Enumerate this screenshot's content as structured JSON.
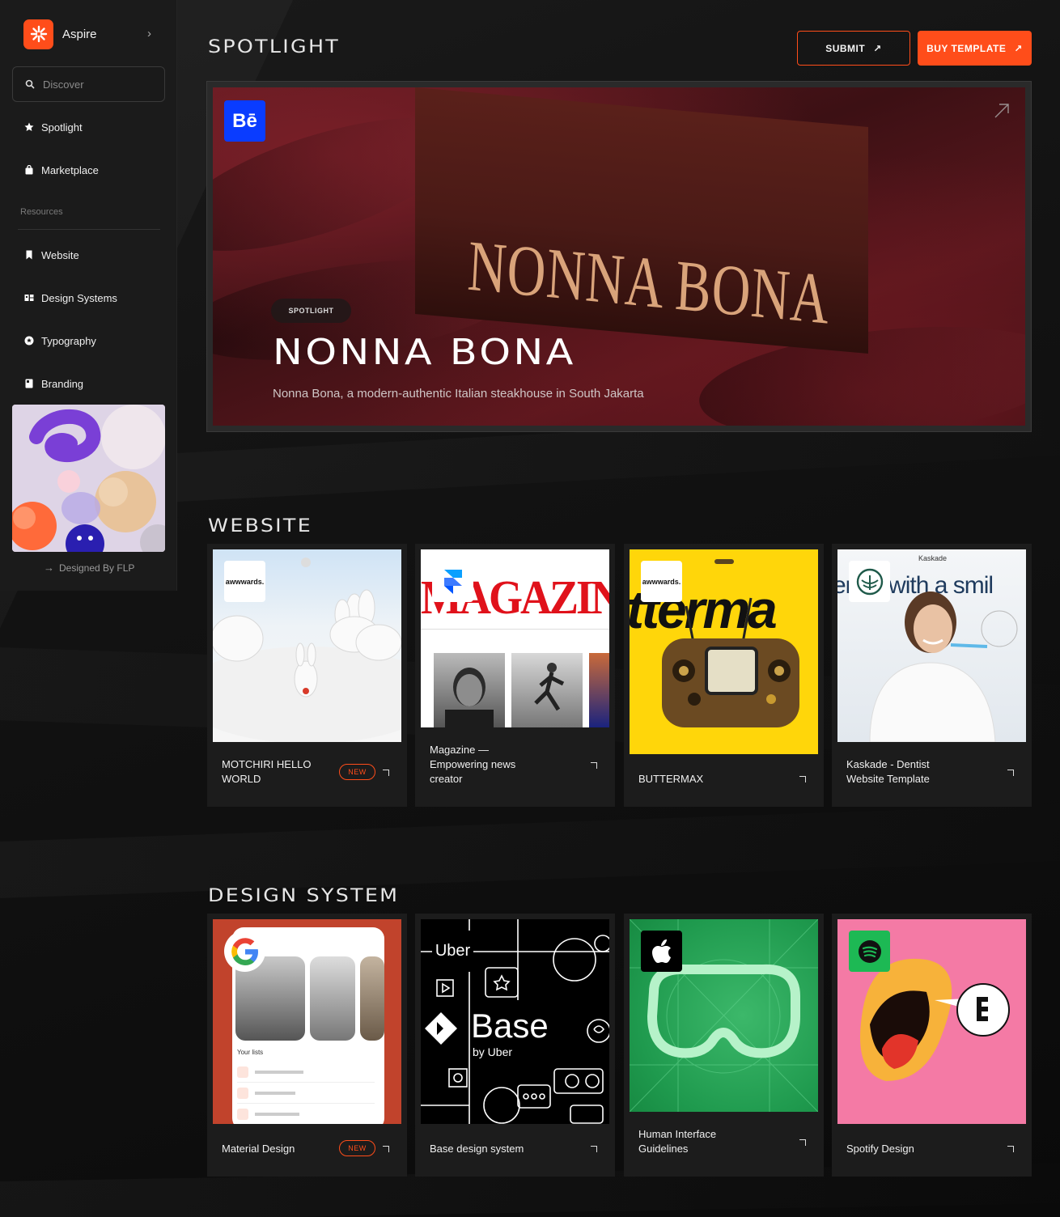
{
  "sidebar": {
    "brand": "Aspire",
    "search_placeholder": "Discover",
    "nav": [
      {
        "label": "Spotlight",
        "icon": "star-icon"
      },
      {
        "label": "Marketplace",
        "icon": "bag-icon"
      }
    ],
    "resources_label": "Resources",
    "resources": [
      {
        "label": "Website",
        "icon": "bookmark-icon"
      },
      {
        "label": "Design Systems",
        "icon": "components-icon"
      },
      {
        "label": "Typography",
        "icon": "type-circle-icon"
      },
      {
        "label": "Branding",
        "icon": "book-icon"
      }
    ],
    "designed_by": "Designed By FLP"
  },
  "header": {
    "title": "SPOTLIGHT",
    "submit_label": "SUBMIT",
    "buy_label": "BUY TEMPLATE"
  },
  "hero": {
    "platform": "Bē",
    "box_text": "NONNA BONA",
    "badge": "SPOTLIGHT",
    "title": "NONNA BONA",
    "subtitle": "Nonna Bona, a modern-authentic Italian steakhouse in South Jakarta"
  },
  "website": {
    "title": "WEBSITE",
    "cards": [
      {
        "title": "MOTCHIRI HELLO WORLD",
        "badge": "NEW",
        "source": "awwwards."
      },
      {
        "title": "Magazine — Empowering news creator",
        "source": "framer",
        "thumb_text": "MAGAZINE"
      },
      {
        "title": "BUTTERMAX",
        "source": "awwwards.",
        "thumb_text": "tterma"
      },
      {
        "title": "Kaskade - Dentist Website Template",
        "source": "kaskade",
        "thumb_text": "entry with a smil",
        "thumb_brand": "Kaskade"
      }
    ]
  },
  "design_system": {
    "title": "DESIGN SYSTEM",
    "cards": [
      {
        "title": "Material Design",
        "badge": "NEW",
        "source": "google",
        "thumb_text": "Your lists"
      },
      {
        "title": "Base design system",
        "source": "Uber",
        "thumb_text": "Base",
        "thumb_sub": "by Uber"
      },
      {
        "title": "Human Interface Guidelines",
        "source": "apple"
      },
      {
        "title": "Spotify Design",
        "source": "spotify"
      }
    ]
  },
  "colors": {
    "accent": "#ff4d1a",
    "bg": "#0c0c0c",
    "card": "#1c1c1c"
  }
}
